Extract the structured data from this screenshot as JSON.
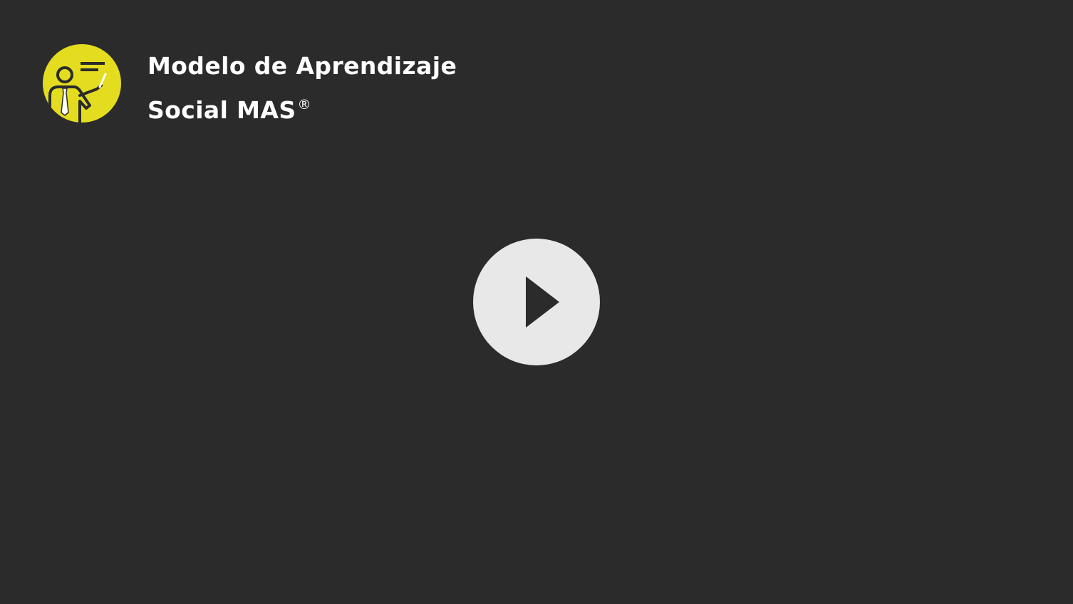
{
  "video": {
    "title_line_1": "Modelo de Aprendizaje",
    "title_line_2": "Social MAS",
    "title_mark": "®"
  },
  "logo": {
    "icon": "teacher-presenting-icon",
    "background_color": "#e4dd1f",
    "figure_color": "#2b2b2b",
    "pointer_color": "#ffffff"
  },
  "player": {
    "background_color": "#2b2b2b",
    "play_icon": "play-icon",
    "play_button_color": "#e8e8e8",
    "play_triangle_color": "#2b2b2b"
  }
}
